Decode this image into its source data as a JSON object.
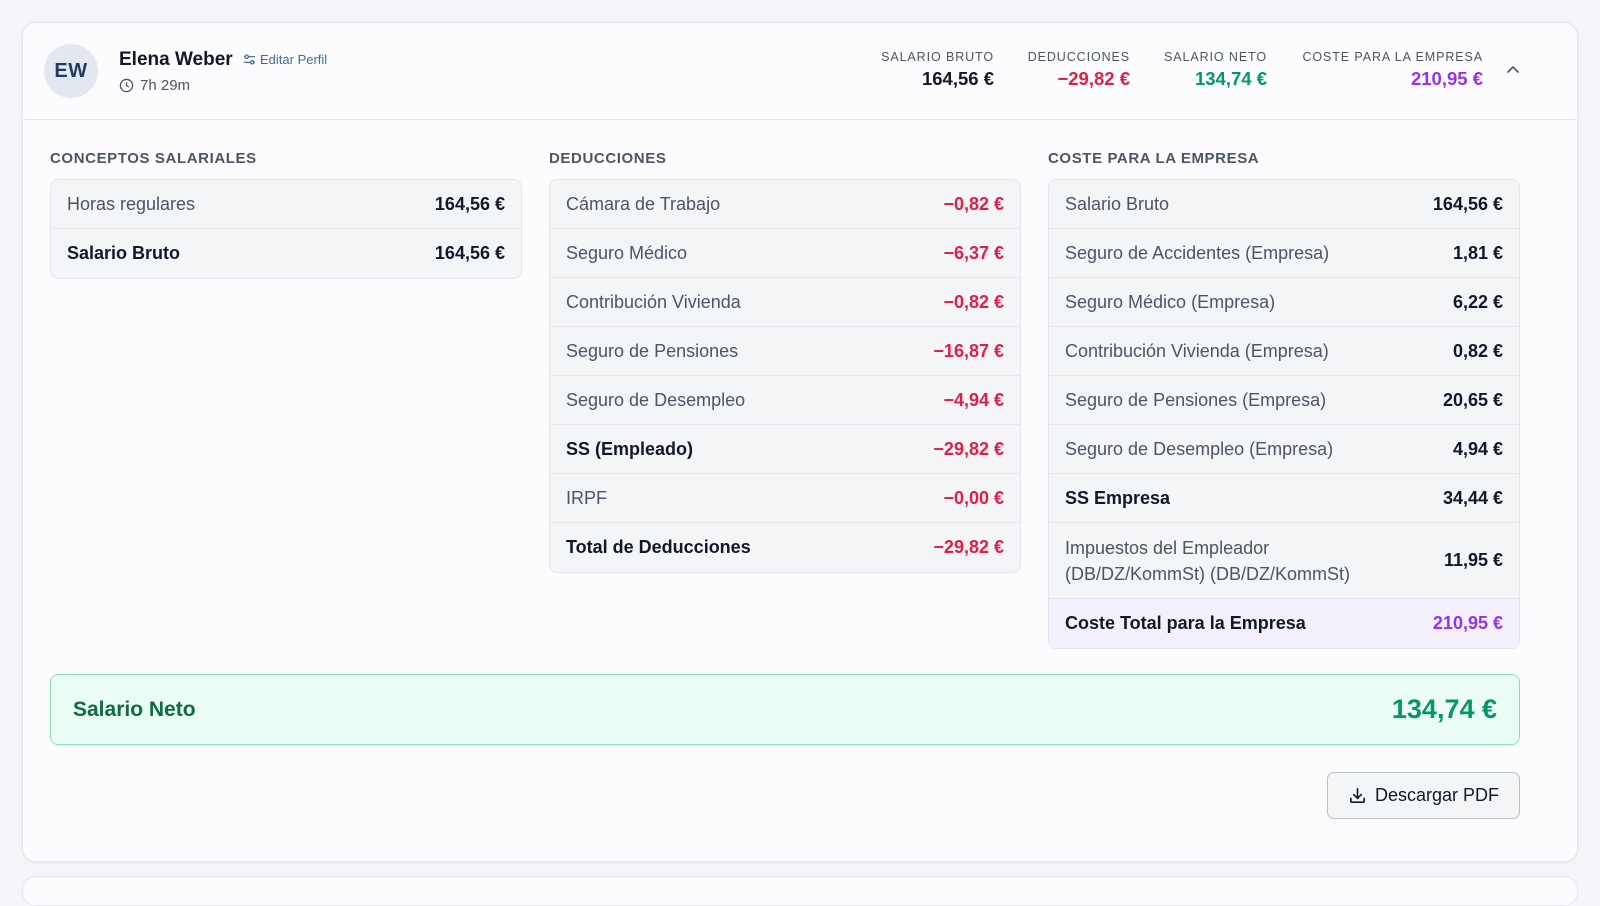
{
  "employee": {
    "initials": "EW",
    "name": "Elena Weber",
    "edit_label": "Editar Perfil",
    "hours": "7h 29m"
  },
  "summary": [
    {
      "label": "SALARIO BRUTO",
      "value": "164,56 €",
      "color": "#111827"
    },
    {
      "label": "DEDUCCIONES",
      "value": "−29,82 €",
      "color": "#e11d48"
    },
    {
      "label": "SALARIO NETO",
      "value": "134,74 €",
      "color": "#059669"
    },
    {
      "label": "COSTE PARA LA EMPRESA",
      "value": "210,95 €",
      "color": "#9333ea"
    }
  ],
  "salary_concepts": {
    "title": "CONCEPTOS SALARIALES",
    "rows": [
      {
        "label": "Horas regulares",
        "amount": "164,56 €"
      },
      {
        "label": "Salario Bruto",
        "amount": "164,56 €"
      }
    ]
  },
  "deductions": {
    "title": "DEDUCCIONES",
    "rows": [
      {
        "label": "Cámara de Trabajo",
        "amount": "−0,82 €"
      },
      {
        "label": "Seguro Médico",
        "amount": "−6,37 €"
      },
      {
        "label": "Contribución Vivienda",
        "amount": "−0,82 €"
      },
      {
        "label": "Seguro de Pensiones",
        "amount": "−16,87 €"
      },
      {
        "label": "Seguro de Desempleo",
        "amount": "−4,94 €"
      },
      {
        "label": "SS (Empleado)",
        "amount": "−29,82 €"
      },
      {
        "label": "IRPF",
        "amount": "−0,00 €"
      },
      {
        "label": "Total de Deducciones",
        "amount": "−29,82 €"
      }
    ]
  },
  "employer_cost": {
    "title": "COSTE PARA LA EMPRESA",
    "rows": [
      {
        "label": "Salario Bruto",
        "amount": "164,56 €"
      },
      {
        "label": "Seguro de Accidentes (Empresa)",
        "amount": "1,81 €"
      },
      {
        "label": "Seguro Médico (Empresa)",
        "amount": "6,22 €"
      },
      {
        "label": "Contribución Vivienda (Empresa)",
        "amount": "0,82 €"
      },
      {
        "label": "Seguro de Pensiones (Empresa)",
        "amount": "20,65 €"
      },
      {
        "label": "Seguro de Desempleo (Empresa)",
        "amount": "4,94 €"
      },
      {
        "label": "SS Empresa",
        "amount": "34,44 €"
      },
      {
        "label": "Impuestos del Empleador",
        "label_line2": "(DB/DZ/KommSt) (DB/DZ/KommSt)",
        "amount": "11,95 €"
      },
      {
        "label": "Coste Total para la Empresa",
        "amount": "210,95 €"
      }
    ]
  },
  "net_salary": {
    "label": "Salario Neto",
    "amount": "134,74 €"
  },
  "actions": {
    "download_pdf": "Descargar PDF"
  },
  "colors": {
    "negative": "#e11d48",
    "positive": "#059669",
    "employer": "#9333ea"
  }
}
